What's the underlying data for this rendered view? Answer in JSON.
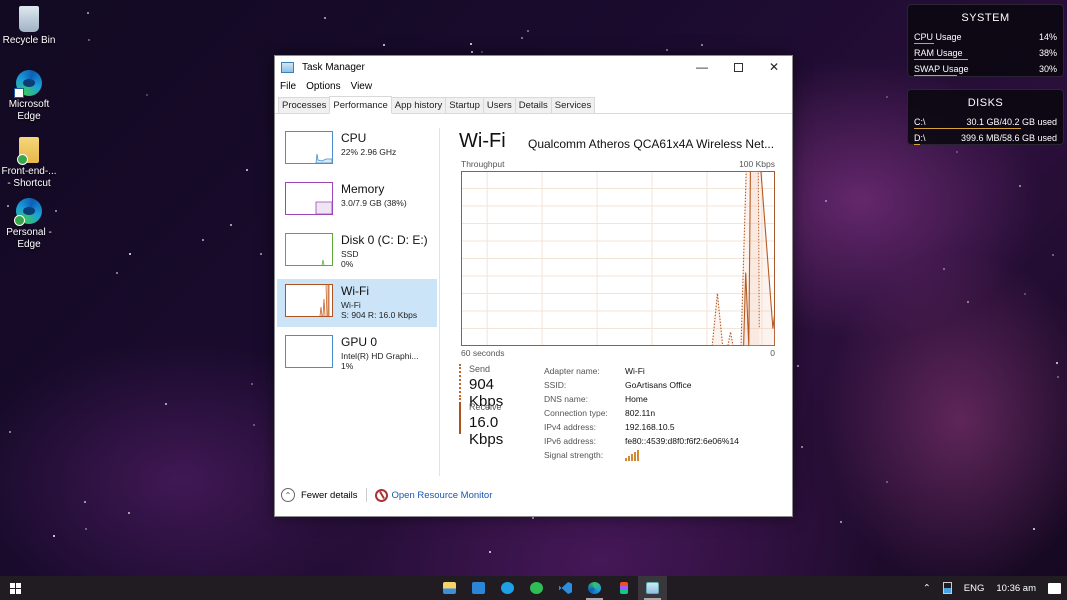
{
  "desktop": {
    "icons": [
      {
        "label": "Recycle Bin",
        "icon": "recycle-bin-icon"
      },
      {
        "label": "Microsoft Edge",
        "icon": "edge-icon"
      },
      {
        "label": "Front-end-... - Shortcut",
        "icon": "folder-shortcut-icon"
      },
      {
        "label": "Personal - Edge",
        "icon": "edge-icon"
      }
    ]
  },
  "widgets": {
    "system": {
      "title": "SYSTEM",
      "rows": [
        {
          "label": "CPU Usage",
          "value": "14%",
          "fraction": 0.14
        },
        {
          "label": "RAM Usage",
          "value": "38%",
          "fraction": 0.38
        },
        {
          "label": "SWAP Usage",
          "value": "30%",
          "fraction": 0.3
        }
      ]
    },
    "disks": {
      "title": "DISKS",
      "rows": [
        {
          "label": "C:\\",
          "value": "30.1 GB/40.2 GB used",
          "fraction": 0.75
        },
        {
          "label": "D:\\",
          "value": "399.6 MB/58.6 GB used",
          "fraction": 0.007
        }
      ]
    }
  },
  "taskmanager": {
    "title": "Task Manager",
    "menu": [
      "File",
      "Options",
      "View"
    ],
    "tabs": [
      "Processes",
      "Performance",
      "App history",
      "Startup",
      "Users",
      "Details",
      "Services"
    ],
    "active_tab": "Performance",
    "sidebar": [
      {
        "name": "CPU",
        "sub1": "22% 2.96 GHz",
        "sub2": "",
        "color": "#4a8fcb"
      },
      {
        "name": "Memory",
        "sub1": "3.0/7.9 GB (38%)",
        "sub2": "",
        "color": "#9b46b6"
      },
      {
        "name": "Disk 0 (C: D: E:)",
        "sub1": "SSD",
        "sub2": "0%",
        "color": "#5caa3a"
      },
      {
        "name": "Wi-Fi",
        "sub1": "Wi-Fi",
        "sub2": "S: 904 R: 16.0 Kbps",
        "color": "#b0521e"
      },
      {
        "name": "GPU 0",
        "sub1": "Intel(R) HD Graphi...",
        "sub2": "1%",
        "color": "#4a8fcb"
      }
    ],
    "main": {
      "title": "Wi-Fi",
      "adapter": "Qualcomm Atheros QCA61x4A Wireless Net...",
      "throughput_label": "Throughput",
      "max_label": "100 Kbps",
      "time_label": "60 seconds",
      "zero_label": "0",
      "send_label": "Send",
      "send_value": "904 Kbps",
      "receive_label": "Receive",
      "receive_value": "16.0 Kbps",
      "properties": [
        {
          "key": "Adapter name:",
          "value": "Wi-Fi"
        },
        {
          "key": "SSID:",
          "value": "GoArtisans Office"
        },
        {
          "key": "DNS name:",
          "value": "Home"
        },
        {
          "key": "Connection type:",
          "value": "802.11n"
        },
        {
          "key": "IPv4 address:",
          "value": "192.168.10.5"
        },
        {
          "key": "IPv6 address:",
          "value": "fe80::4539:d8f0:f6f2:6e06%14"
        },
        {
          "key": "Signal strength:",
          "value": ""
        }
      ],
      "signal_bars": 5
    },
    "footer": {
      "fewer_details": "Fewer details",
      "open_resource_monitor": "Open Resource Monitor"
    }
  },
  "chart_data": {
    "type": "line",
    "title": "Throughput",
    "xlabel": "60 seconds",
    "ylabel": "Kbps",
    "xlim": [
      60,
      0
    ],
    "ylim": [
      0,
      100
    ],
    "grid": true,
    "series": [
      {
        "name": "Send",
        "style": "dotted",
        "points": [
          [
            12,
            0
          ],
          [
            11,
            30
          ],
          [
            10,
            0
          ],
          [
            9,
            0
          ],
          [
            8.5,
            8
          ],
          [
            8,
            0
          ],
          [
            6.5,
            0
          ],
          [
            5.5,
            100
          ],
          [
            4.5,
            100
          ],
          [
            4,
            100
          ],
          [
            3.6,
            100
          ],
          [
            3.2,
            100
          ],
          [
            3,
            10
          ]
        ]
      },
      {
        "name": "Receive",
        "style": "solid",
        "points": [
          [
            6,
            0
          ],
          [
            5.6,
            42
          ],
          [
            5,
            0
          ],
          [
            4.7,
            100
          ],
          [
            4.2,
            100
          ],
          [
            3.8,
            100
          ],
          [
            3.5,
            100
          ],
          [
            3.2,
            100
          ],
          [
            2.7,
            100
          ],
          [
            0.4,
            10
          ],
          [
            0,
            20
          ]
        ]
      }
    ]
  },
  "taskbar": {
    "apps": [
      "file-explorer",
      "mail",
      "skype",
      "whatsapp",
      "vscode",
      "edge",
      "figma",
      "task-manager"
    ],
    "tray": {
      "language": "ENG",
      "time": "10:36 am"
    }
  }
}
